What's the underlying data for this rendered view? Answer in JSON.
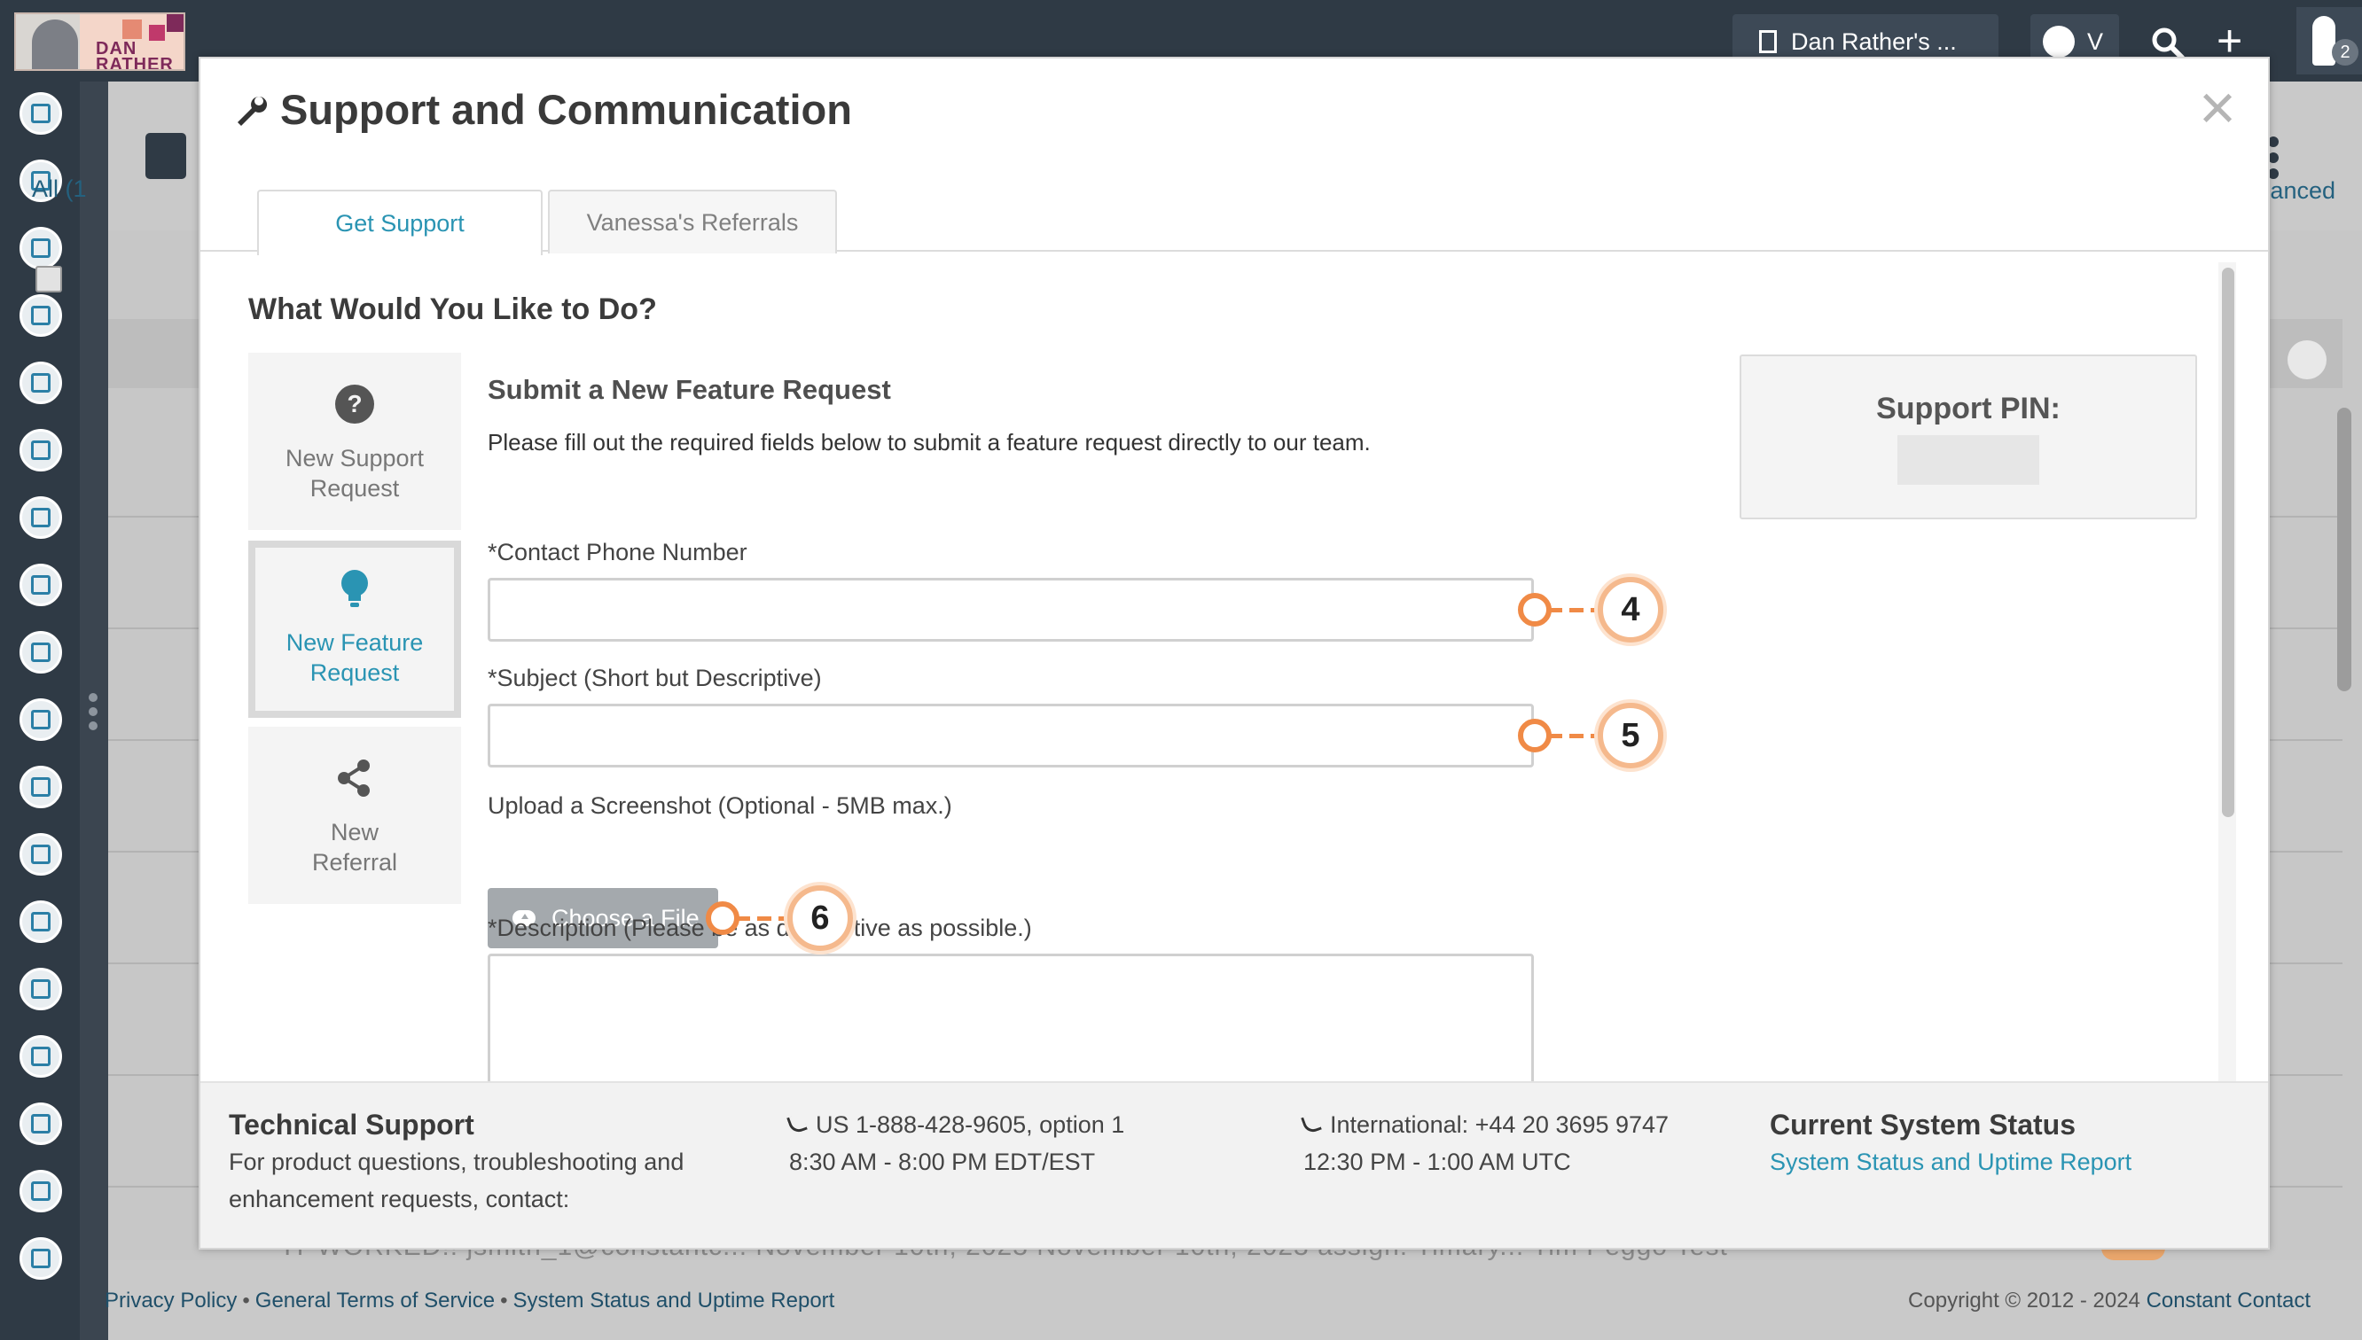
{
  "topbar": {
    "logo_text": "DAN RATHER",
    "org_label": "Dan Rather's ...",
    "user_initial": "V",
    "notification_count": "2"
  },
  "sidebar": {
    "icons": [
      "contacts-icon",
      "email-icon",
      "clipboard-icon",
      "map-icon",
      "branch-icon",
      "list-icon",
      "megaphone-icon",
      "survey-icon",
      "thumbs-up-icon",
      "tv-icon",
      "gallery-icon",
      "calendar-icon",
      "handshake-icon",
      "chart-icon",
      "headset-icon",
      "user-star-icon",
      "bar-chart-icon",
      "plug-icon"
    ]
  },
  "background": {
    "all_tab": "All (1",
    "advanced": "anced",
    "peek_row": "IT WORKED!!  jsmith_1@constantc...  November 10th, 2023  November 10th, 2023  assign: Timary...  Tim Peggo Test",
    "footer_links": [
      "Privacy Policy",
      "General Terms of Service",
      "System Status and Uptime Report"
    ],
    "copyright_prefix": "Copyright © 2012 - 2024 ",
    "copyright_company": "Constant Contact"
  },
  "modal": {
    "title": "Support and Communication",
    "close_symbol": "×",
    "tabs": [
      {
        "label": "Get Support",
        "active": true
      },
      {
        "label": "Vanessa's Referrals",
        "active": false
      }
    ],
    "heading": "What Would You Like to Do?",
    "options": [
      {
        "label_line1": "New Support",
        "label_line2": "Request",
        "icon": "question-circle-icon",
        "selected": false
      },
      {
        "label_line1": "New Feature",
        "label_line2": "Request",
        "icon": "lightbulb-icon",
        "selected": true
      },
      {
        "label_line1": "New",
        "label_line2": "Referral",
        "icon": "share-icon",
        "selected": false
      }
    ],
    "form": {
      "title": "Submit a New Feature Request",
      "description": "Please fill out the required fields below to submit a feature request directly to our team.",
      "phone_label": "*Contact Phone Number",
      "phone_value": "",
      "subject_label": "*Subject (Short but Descriptive)",
      "subject_value": "",
      "upload_label": "Upload a Screenshot (Optional - 5MB max.)",
      "choose_file": "Choose a File",
      "description_label": "*Description (Please be as descriptive as possible.)",
      "description_value": ""
    },
    "support_pin": {
      "title": "Support PIN:",
      "value": ""
    },
    "callouts": [
      "4",
      "5",
      "6"
    ],
    "footer": {
      "tech_title": "Technical Support",
      "tech_line1": "For product questions, troubleshooting and",
      "tech_line2": "enhancement requests, contact:",
      "us_phone": "US 1-888-428-9605, option 1",
      "us_hours": "8:30 AM - 8:00 PM EDT/EST",
      "intl_phone": "International: +44 20 3695 9747",
      "intl_hours": "12:30 PM - 1:00 AM UTC",
      "status_title": "Current System Status",
      "status_link": "System Status and Uptime Report"
    }
  },
  "colors": {
    "accent": "#2a94b3",
    "callout": "#f08a46",
    "sidebar_bg": "#2f3a45"
  }
}
